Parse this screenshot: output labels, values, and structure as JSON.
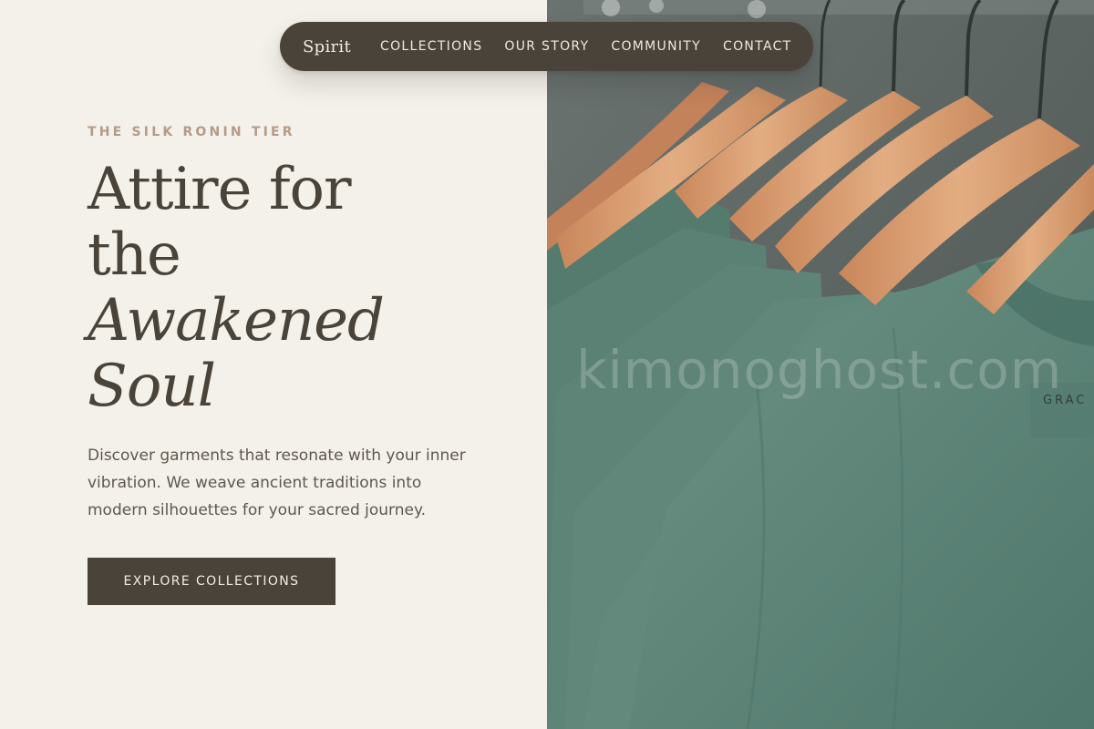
{
  "nav": {
    "brand": "Spirit",
    "links": [
      "COLLECTIONS",
      "OUR STORY",
      "COMMUNITY",
      "CONTACT"
    ]
  },
  "hero": {
    "eyebrow": "THE SILK RONIN TIER",
    "headline_line1": "Attire for",
    "headline_line2": "the",
    "headline_line3": "Awakened",
    "headline_line4": "Soul",
    "description": "Discover garments that resonate with your inner vibration. We weave ancient traditions into modern silhouettes for your sacred journey.",
    "cta_label": "EXPLORE COLLECTIONS"
  },
  "image": {
    "watermark": "kimonoghost.com",
    "label_text": "GRAC"
  },
  "colors": {
    "background": "#f4f1ea",
    "primary_dark": "#4a4339",
    "eyebrow": "#b49b88",
    "body_text": "#5e574e",
    "shirt_green": "#5e8679",
    "hanger_wood": "#d69a6c"
  }
}
